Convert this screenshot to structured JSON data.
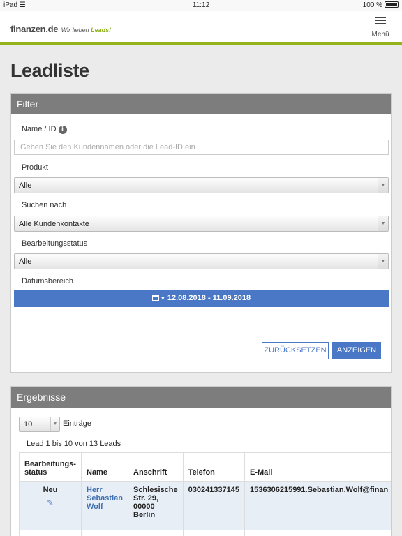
{
  "statusbar": {
    "device": "iPad",
    "time": "11:12",
    "battery": "100 %"
  },
  "header": {
    "brand": "finanzen.de",
    "tagline_pre": "Wir lieben ",
    "tagline_accent": "Leads!",
    "menu_label": "Menü",
    "accent_color": "#95b31c"
  },
  "page": {
    "title": "Leadliste"
  },
  "filter": {
    "heading": "Filter",
    "name_label": "Name / ID",
    "name_placeholder": "Geben Sie den Kundennamen oder die Lead-ID ein",
    "produkt_label": "Produkt",
    "produkt_value": "Alle",
    "suchen_label": "Suchen nach",
    "suchen_value": "Alle Kundenkontakte",
    "status_label": "Bearbeitungsstatus",
    "status_value": "Alle",
    "datum_label": "Datumsbereich",
    "datum_value": "12.08.2018 - 11.09.2018",
    "reset_label": "ZURÜCKSETZEN",
    "show_label": "ANZEIGEN"
  },
  "results": {
    "heading": "Ergebnisse",
    "page_length": "10",
    "entries_label": "Einträge",
    "info": "Lead 1 bis 10 von 13 Leads",
    "columns": [
      "Bearbeitungs-status",
      "Name",
      "Anschrift",
      "Telefon",
      "E-Mail"
    ],
    "rows": [
      {
        "status": "Neu",
        "name": "Herr Sebastian Wolf",
        "address": "Schlesische Str. 29, 00000 Berlin",
        "phone": "030241337145",
        "email": "1536306215991.Sebastian.Wolf@finan"
      }
    ]
  }
}
